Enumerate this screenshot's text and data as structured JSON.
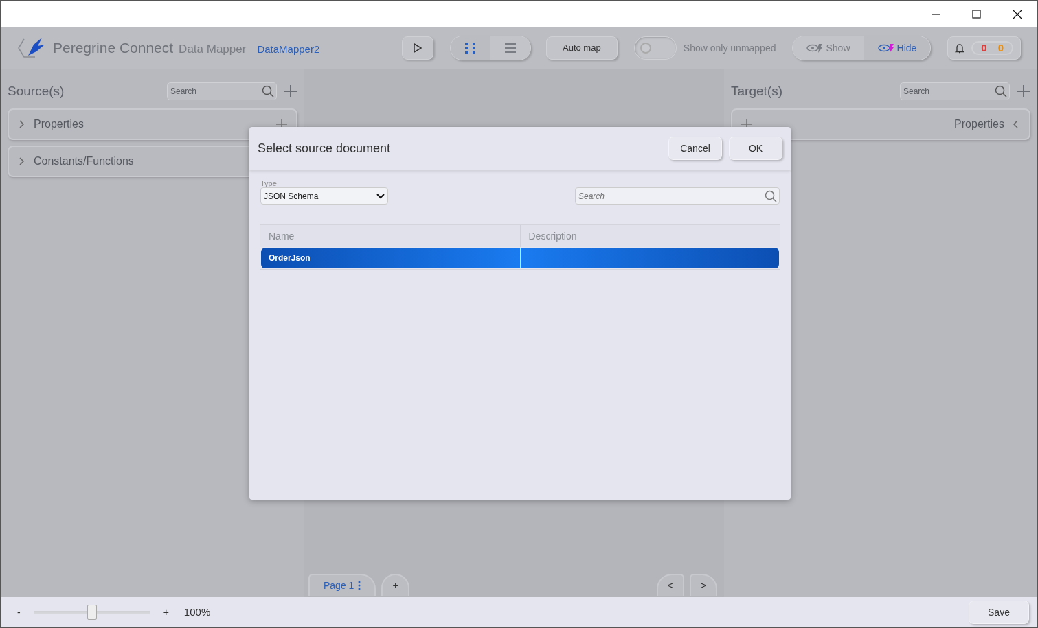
{
  "header": {
    "app_name": "Peregrine Connect",
    "product": "Data Mapper",
    "document": "DataMapper2",
    "view_modes": [
      {
        "kind": "grid",
        "selected": true
      },
      {
        "kind": "list",
        "selected": false
      }
    ],
    "auto_map": "Auto map",
    "unmapped_toggle": {
      "label": "Show only unmapped",
      "on": false
    },
    "visibility": [
      {
        "label": "Show",
        "selected": false
      },
      {
        "label": "Hide",
        "selected": true
      }
    ],
    "counters": [
      {
        "text": "0",
        "color": "#e53935"
      },
      {
        "text": "0",
        "color": "#f08c00"
      }
    ]
  },
  "sources": {
    "title": "Source(s)",
    "search": {
      "placeholder": "Search"
    },
    "panels": [
      {
        "label": "Properties",
        "expanded": false,
        "addable": true
      },
      {
        "label": "Constants/Functions",
        "expanded": false,
        "addable": false
      }
    ]
  },
  "targets": {
    "title": "Target(s)",
    "search": {
      "placeholder": "Search"
    },
    "panels": [
      {
        "label": "Properties",
        "expanded": false,
        "addable": true
      }
    ]
  },
  "pages": {
    "tabs": [
      {
        "label": "Page 1",
        "selected": true
      }
    ],
    "add": "+",
    "nav": [
      "<",
      ">"
    ]
  },
  "footer": {
    "zoom_out": "-",
    "zoom": {
      "level": 0.5
    },
    "zoom_in": "+",
    "reading": "100%",
    "save": "Save"
  },
  "dialog": {
    "title": "Select source document",
    "buttons": [
      "Cancel",
      "OK"
    ],
    "type": {
      "label": "Type",
      "value": "JSON Schema"
    },
    "search": {
      "placeholder": "Search"
    },
    "columns": [
      "Name",
      "Description"
    ],
    "rows": [
      {
        "name": "OrderJson",
        "selected": true
      }
    ]
  }
}
